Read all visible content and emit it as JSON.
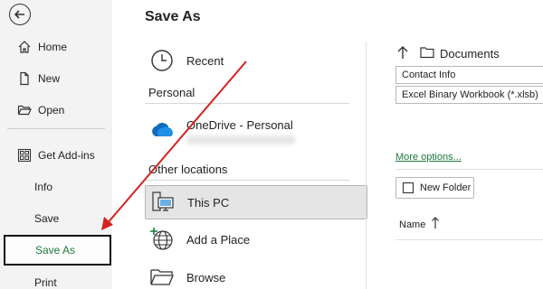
{
  "nav": {
    "items": [
      {
        "label": "Home",
        "icon": "home-icon"
      },
      {
        "label": "New",
        "icon": "new-document-icon"
      },
      {
        "label": "Open",
        "icon": "open-folder-icon"
      },
      {
        "label": "Get Add-ins",
        "icon": "addins-grid-icon"
      },
      {
        "label": "Info"
      },
      {
        "label": "Save"
      },
      {
        "label": "Save As",
        "selected": true
      },
      {
        "label": "Print"
      }
    ]
  },
  "page": {
    "title": "Save As"
  },
  "locations": {
    "recent": "Recent",
    "personal_header": "Personal",
    "onedrive": "OneDrive - Personal",
    "other_header": "Other locations",
    "this_pc": "This PC",
    "add_place": "Add a Place",
    "browse": "Browse"
  },
  "save": {
    "current_folder": "Documents",
    "filename": "Contact Info",
    "file_type": "Excel Binary Workbook (*.xlsb)",
    "more_options": "More options...",
    "new_folder": "New Folder",
    "name_column": "Name"
  },
  "colors": {
    "accent_green": "#1b7a3c",
    "annotation_red": "#d62020",
    "nav_bg": "#f3f3f3",
    "selected_location_bg": "#e5e5e5"
  }
}
